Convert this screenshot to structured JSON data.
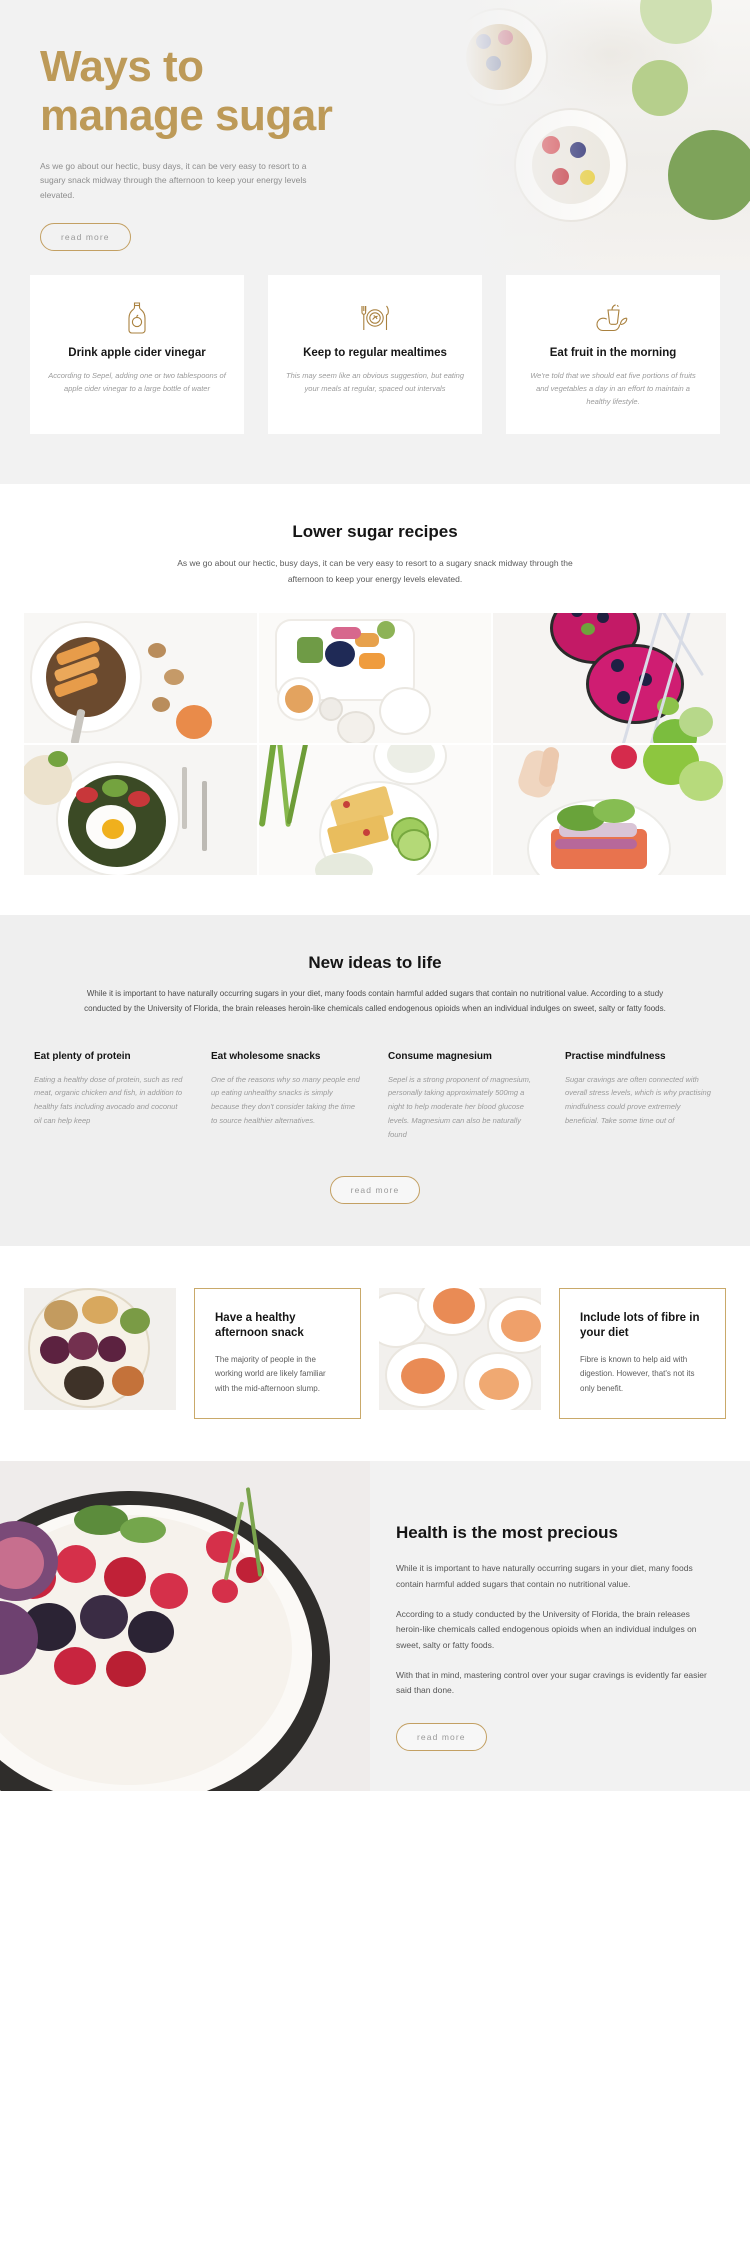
{
  "hero": {
    "title_line1": "Ways to",
    "title_line2": "manage sugar",
    "subtitle": "As we go about our hectic, busy days, it can be very easy to resort to a sugary snack midway through the afternoon to keep your energy levels elevated.",
    "cta_label": "read more",
    "accent_color": "#bd9a58"
  },
  "feature_cards": [
    {
      "icon": "vinegar-bottle-icon",
      "title": "Drink apple cider vinegar",
      "text": "According to Sepel, adding one or two tablespoons of apple cider vinegar to a large bottle of water"
    },
    {
      "icon": "plate-cutlery-icon",
      "title": "Keep to regular mealtimes",
      "text": "This may seem like an obvious suggestion, but eating your meals at regular, spaced out intervals"
    },
    {
      "icon": "fruit-juice-icon",
      "title": "Eat fruit in the morning",
      "text": "We're told that we should eat five portions of fruits and vegetables a day in an effort to maintain a healthy lifestyle."
    }
  ],
  "recipes": {
    "title": "Lower sugar recipes",
    "lead": "As we go about our hectic, busy days, it can be very easy to resort to a sugary snack midway through the afternoon to keep your energy levels elevated.",
    "photos": [
      "granola-bowl-with-peach-photo",
      "fruit-platter-breakfast-photo",
      "pink-smoothie-bowls-photo",
      "fried-egg-salad-photo",
      "cornbread-cucumber-photo",
      "salmon-open-sandwich-photo"
    ]
  },
  "ideas": {
    "title": "New ideas to life",
    "lead": "While it is important to have naturally occurring sugars in your diet, many foods contain harmful added sugars that contain no nutritional value.  According to a study conducted by the University of Florida, the brain releases heroin-like chemicals called endogenous opioids when an individual indulges on sweet, salty or fatty foods.",
    "columns": [
      {
        "title": "Eat plenty of protein",
        "text": "Eating a healthy dose of protein, such as red meat, organic chicken and fish, in addition to healthy fats including avocado and coconut oil can help keep"
      },
      {
        "title": "Eat wholesome snacks",
        "text": "One of the reasons why so many people end up eating unhealthy snacks is simply because they don't consider taking the time to source healthier alternatives."
      },
      {
        "title": "Consume magnesium",
        "text": "Sepel is a strong proponent of magnesium, personally taking approximately 500mg a night to help moderate her blood glucose levels. Magnesium can also be naturally found"
      },
      {
        "title": "Practise mindfulness",
        "text": "Sugar cravings are often connected with overall stress levels, which is why practising mindfulness could prove extremely beneficial. Take some time out of"
      }
    ],
    "cta_label": "read more"
  },
  "quotes": {
    "photo_left": "grazing-board-with-grapes-photo",
    "photo_mid": "brunch-table-spread-photo",
    "cards": [
      {
        "title": "Have a healthy afternoon snack",
        "text": "The majority of people in the working world are likely familiar with the mid-afternoon slump."
      },
      {
        "title": "Include lots of fibre in your diet",
        "text": "Fibre is known to help aid with digestion. However, that's not its only benefit."
      }
    ]
  },
  "final": {
    "photo": "berry-yogurt-bowl-photo",
    "title": "Health is the most precious",
    "paragraphs": [
      "While it is important to have naturally occurring sugars in your diet, many foods contain harmful added sugars that contain no nutritional value.",
      "According to a study conducted by the University of Florida, the brain releases heroin-like chemicals called endogenous opioids when an individual indulges on sweet, salty or fatty foods.",
      "With that in mind, mastering control over your sugar cravings is evidently far easier said than done."
    ],
    "cta_label": "read more"
  }
}
